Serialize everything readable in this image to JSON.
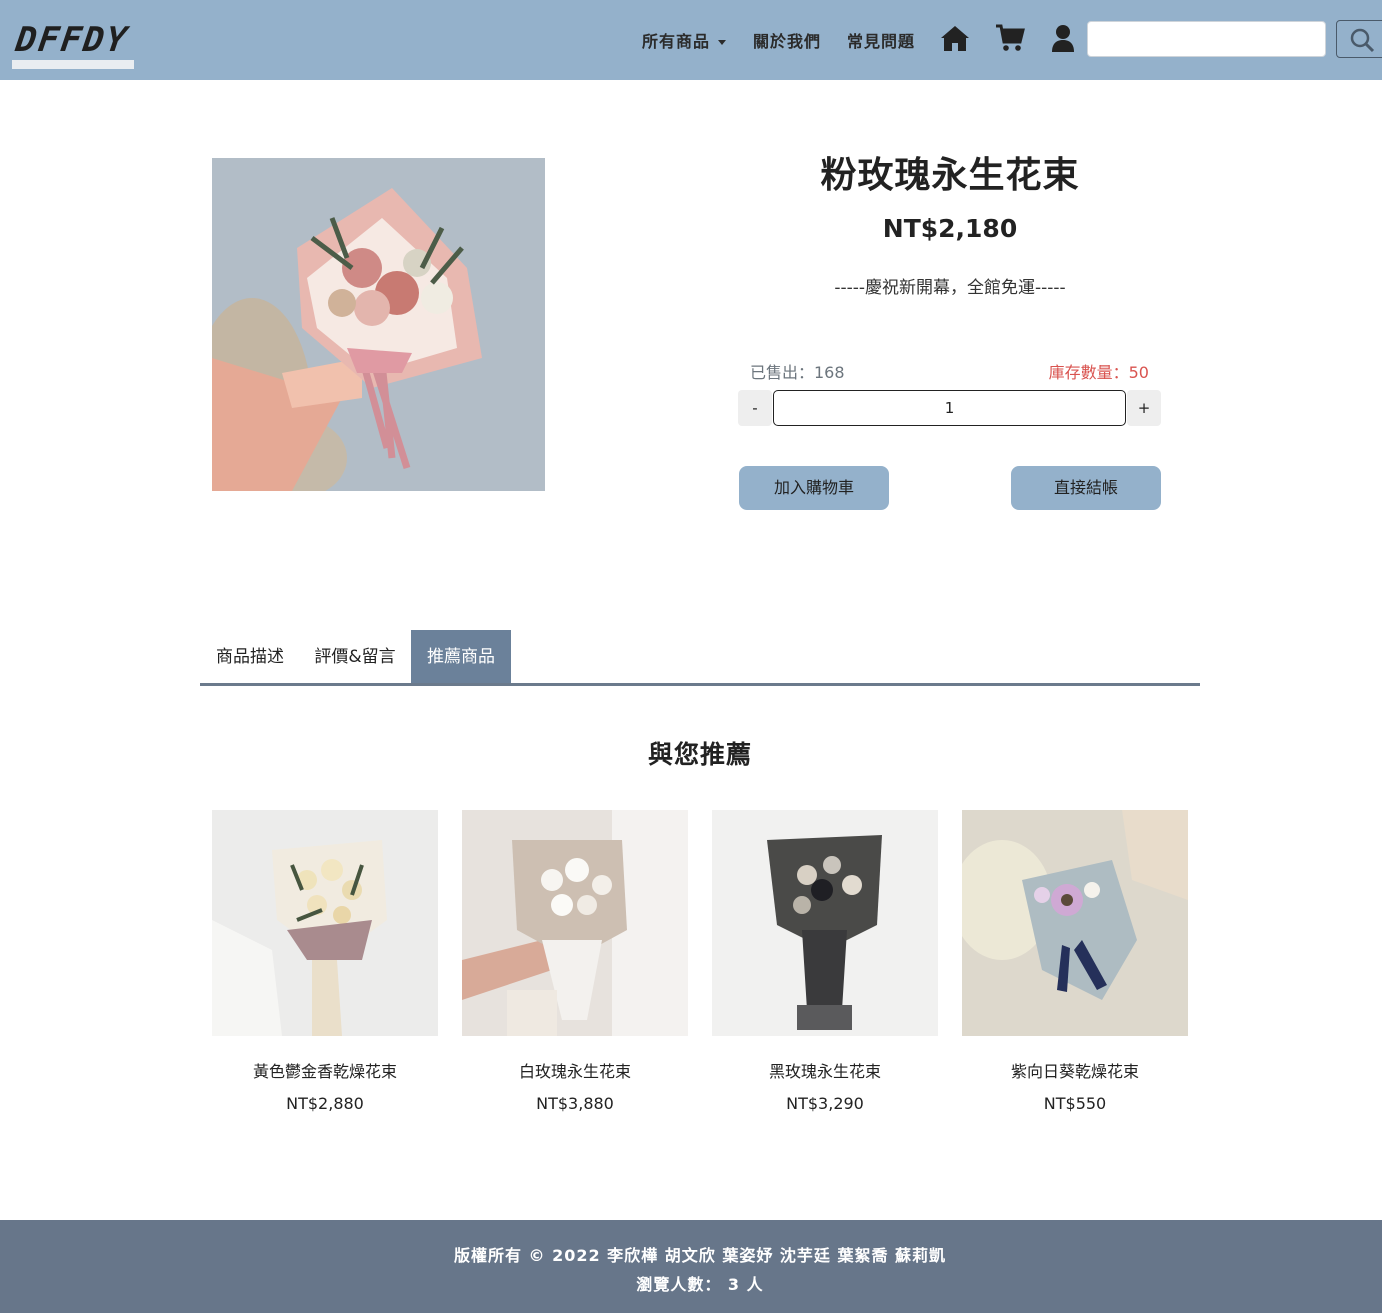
{
  "nav": {
    "logo": "DFFDY",
    "all_products": "所有商品",
    "about": "關於我們",
    "faq": "常見問題",
    "icons": [
      "home-icon",
      "cart-icon",
      "user-icon",
      "search-icon"
    ],
    "search_value": ""
  },
  "product": {
    "title": "粉玫瑰永生花束",
    "price": "NT$2,180",
    "promo": "-----慶祝新開幕，全館免運-----",
    "sold": "已售出：168",
    "stock": "庫存數量：50",
    "quantity": "1",
    "minus": "-",
    "plus": "+",
    "add_to_cart": "加入購物車",
    "checkout": "直接結帳"
  },
  "tabs": [
    "商品描述",
    "評價&留言",
    "推薦商品"
  ],
  "active_tab": "推薦商品",
  "recommend": {
    "title": "與您推薦",
    "items": [
      {
        "name": "黃色鬱金香乾燥花束",
        "price": "NT$2,880"
      },
      {
        "name": "白玫瑰永生花束",
        "price": "NT$3,880"
      },
      {
        "name": "黑玫瑰永生花束",
        "price": "NT$3,290"
      },
      {
        "name": "紫向日葵乾燥花束",
        "price": "NT$550"
      }
    ]
  },
  "footer": {
    "copyright": "版權所有 © 2022 李欣樺 胡文欣 葉姿妤 沈芋廷 葉絮喬 蘇莉凱",
    "visitors": "瀏覽人數： 3 人"
  },
  "colors": {
    "nav_bg": "#94b1cb",
    "button_bg": "#94b1cb",
    "active_tab_bg": "#6b819a",
    "footer_bg": "#67768a",
    "stock_text": "#d9534f"
  }
}
